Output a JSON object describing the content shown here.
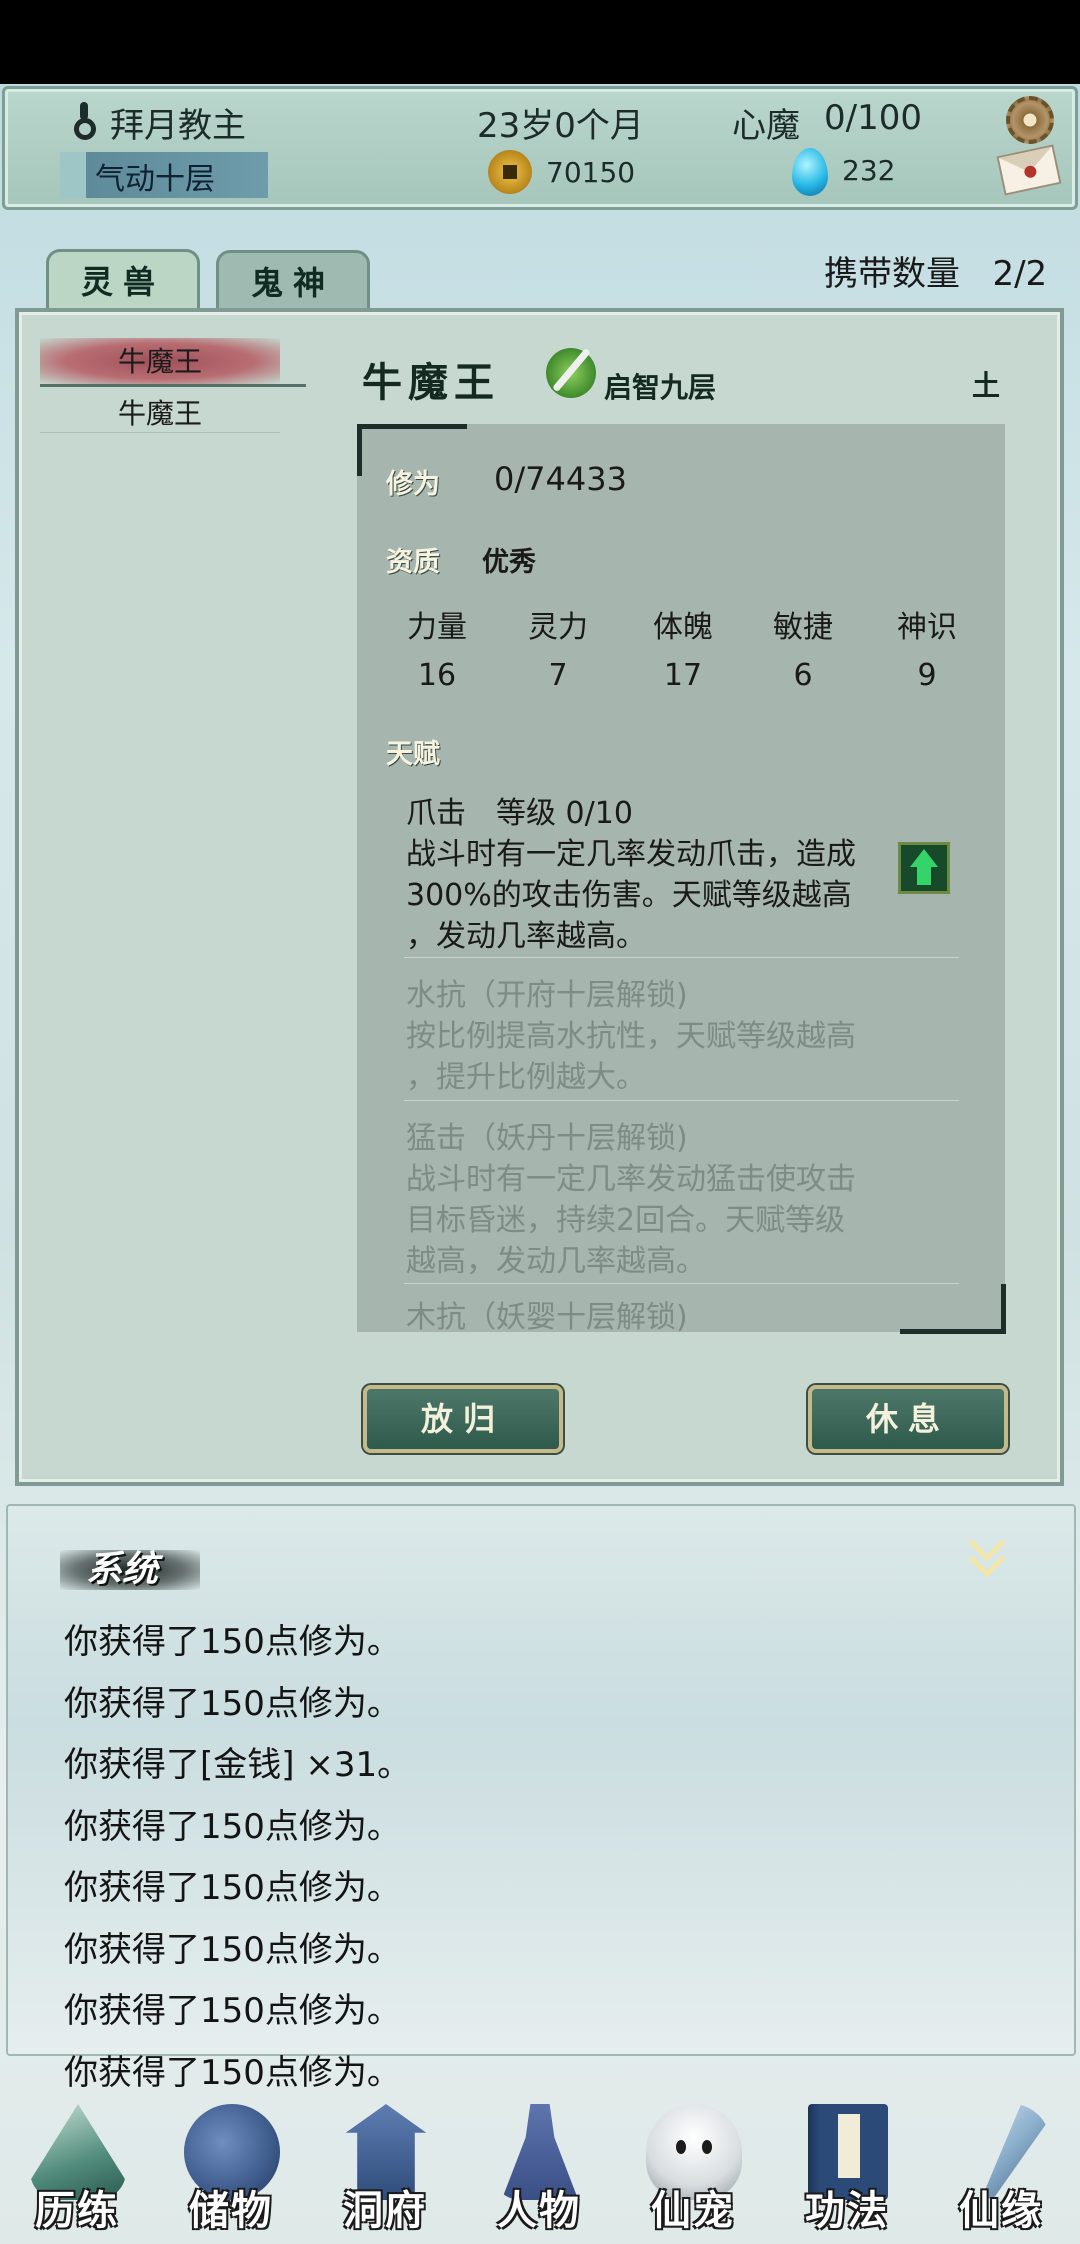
{
  "header": {
    "player_title": "拜月教主",
    "age": "23岁0个月",
    "heart_demon_label": "心魔",
    "heart_demon_value": "0/100",
    "realm": "气动十层",
    "coins": "70150",
    "gems": "232"
  },
  "tabs": [
    {
      "label": "灵兽"
    },
    {
      "label": "鬼神"
    }
  ],
  "carry": {
    "label": "携带数量",
    "value": "2/2"
  },
  "pet_list": [
    "牛魔王",
    "牛魔王"
  ],
  "pet": {
    "name": "牛魔王",
    "stage": "启智九层",
    "element": "土",
    "cultivation_label": "修为",
    "cultivation_value": "0/74433",
    "aptitude_label": "资质",
    "aptitude_value": "优秀",
    "stats": [
      {
        "name": "力量",
        "value": "16"
      },
      {
        "name": "灵力",
        "value": "7"
      },
      {
        "name": "体魄",
        "value": "17"
      },
      {
        "name": "敏捷",
        "value": "6"
      },
      {
        "name": "神识",
        "value": "9"
      }
    ],
    "talent_label": "天赋",
    "talents": [
      {
        "title": "爪击　等级 0/10",
        "lines": [
          "战斗时有一定几率发动爪击，造成",
          "300%的攻击伤害。天赋等级越高",
          "，发动几率越高。"
        ]
      },
      {
        "title": "水抗（开府十层解锁)",
        "lines": [
          "按比例提高水抗性，天赋等级越高",
          "，提升比例越大。"
        ]
      },
      {
        "title": "猛击（妖丹十层解锁)",
        "lines": [
          "战斗时有一定几率发动猛击使攻击",
          "目标昏迷，持续2回合。天赋等级",
          "越高，发动几率越高。"
        ]
      },
      {
        "title": "木抗（妖婴十层解锁)",
        "lines": []
      }
    ]
  },
  "actions": {
    "release": "放归",
    "rest": "休息"
  },
  "log": {
    "title": "系统",
    "lines": [
      "你获得了150点修为。",
      "你获得了150点修为。",
      "你获得了[金钱] ×31。",
      "你获得了150点修为。",
      "你获得了150点修为。",
      "你获得了150点修为。",
      "你获得了150点修为。",
      "你获得了150点修为。"
    ]
  },
  "nav": [
    {
      "label": "历练",
      "icon": "mountain-icon",
      "color": "#4f8a7a"
    },
    {
      "label": "储物",
      "icon": "bag-icon",
      "color": "#3e5b8c"
    },
    {
      "label": "洞府",
      "icon": "palace-icon",
      "color": "#2f4c7a"
    },
    {
      "label": "人物",
      "icon": "person-icon",
      "color": "#3a4f86"
    },
    {
      "label": "仙宠",
      "icon": "ghost-pet-icon",
      "color": "#d8dde0"
    },
    {
      "label": "功法",
      "icon": "book-icon",
      "color": "#2c4a78"
    },
    {
      "label": "仙缘",
      "icon": "feather-icon",
      "color": "#8fb2cf"
    }
  ]
}
